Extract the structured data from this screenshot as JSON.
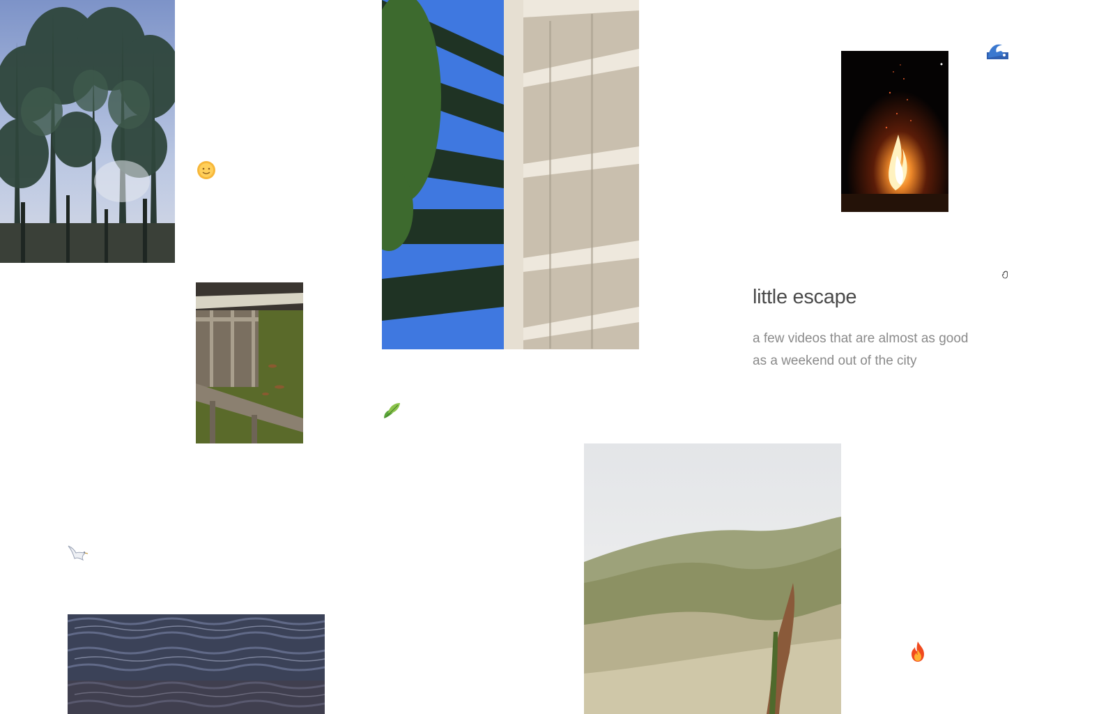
{
  "page": {
    "title": "little escape",
    "subtitle": "a few videos that are almost as good as a weekend out of the city"
  },
  "videos": [
    {
      "name": "trees-video",
      "subject": "pine trees against blue sky"
    },
    {
      "name": "pergola-video",
      "subject": "white wooden pergola with vines and blue sky"
    },
    {
      "name": "bonfire-video",
      "subject": "bonfire at night"
    },
    {
      "name": "pond-video",
      "subject": "wooden dock over green pond with fish"
    },
    {
      "name": "hills-video",
      "subject": "grassy hills with a dirt trail"
    },
    {
      "name": "water-video",
      "subject": "rippling lake water"
    }
  ],
  "emojis": {
    "sun": "🌞",
    "wave": "🌊",
    "leaf": "🍃",
    "dove": "🕊",
    "fire": "🔥",
    "hand": "✋"
  },
  "colors": {
    "background": "#ffffff",
    "title": "#4a4a4a",
    "subtitle": "#8a8a8a"
  }
}
